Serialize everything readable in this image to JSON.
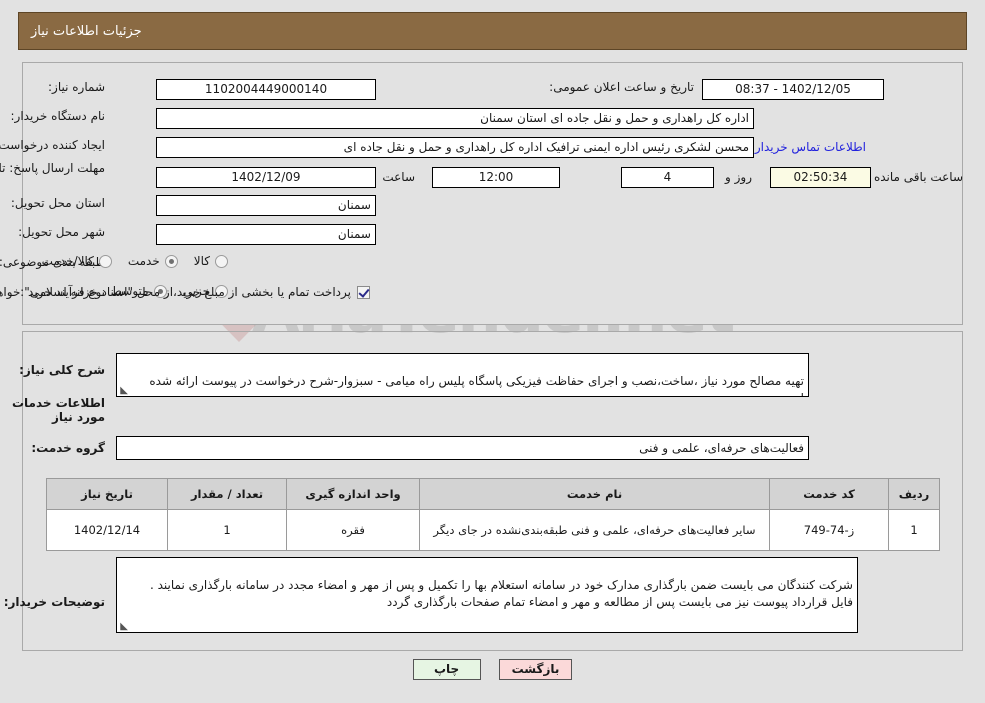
{
  "header": {
    "title": "جزئیات اطلاعات نیاز"
  },
  "form": {
    "need_number_label": "شماره نیاز:",
    "need_number_value": "1102004449000140",
    "announce_label": "تاریخ و ساعت اعلان عمومی:",
    "announce_value": "08:37 - 1402/12/05",
    "buyer_org_label": "نام دستگاه خریدار:",
    "buyer_org_value": "اداره کل راهداری و حمل و نقل جاده ای استان سمنان",
    "requester_label": "ایجاد کننده درخواست:",
    "requester_value": "محسن لشکری رئیس اداره ایمنی ترافیک اداره کل راهداری و حمل و نقل جاده ای",
    "buyer_contact_link": "اطلاعات تماس خریدار",
    "deadline_label": "مهلت ارسال پاسخ: تا تاریخ:",
    "deadline_date": "1402/12/09",
    "hour_label": "ساعت",
    "deadline_hour": "12:00",
    "days_value": "4",
    "days_label": "روز و",
    "countdown_value": "02:50:34",
    "countdown_label": "ساعت باقی مانده",
    "province_label": "استان محل تحویل:",
    "province_value": "سمنان",
    "city_label": "شهر محل تحویل:",
    "city_value": "سمنان",
    "category_label": "طبقه بندی موضوعی:",
    "category_options": [
      {
        "label": "کالا",
        "selected": false
      },
      {
        "label": "خدمت",
        "selected": true
      },
      {
        "label": "کالا/خدمت",
        "selected": false
      }
    ],
    "process_label": "نوع فرآیند خرید :",
    "process_options": [
      {
        "label": "جزیی",
        "selected": false
      },
      {
        "label": "متوسط",
        "selected": true
      }
    ],
    "treasury_checkbox_checked": true,
    "treasury_note": "پرداخت تمام یا بخشی از مبلغ خرید،از محل \"اسناد خزانه اسلامی\" خواهد بود."
  },
  "summary": {
    "label": "شرح کلی نیاز:",
    "value": "تهیه مصالح مورد نیاز ،ساخت،نصب و اجرای حفاظت فیزیکی پاسگاه پلیس راه میامی - سبزوار-شرح درخواست در پیوست ارائه شده است."
  },
  "services_section": {
    "title": "اطلاعات خدمات مورد نیاز",
    "group_label": "گروه خدمت:",
    "group_value": "فعالیت‌های حرفه‌ای، علمی و فنی"
  },
  "table": {
    "columns": [
      "ردیف",
      "کد خدمت",
      "نام خدمت",
      "واحد اندازه گیری",
      "تعداد / مقدار",
      "تاریخ نیاز"
    ],
    "rows": [
      {
        "index": "1",
        "code": "ز-74-749",
        "name": "سایر فعالیت‌های حرفه‌ای، علمی و فنی طبقه‌بندی‌نشده در جای دیگر",
        "unit": "فقره",
        "quantity": "1",
        "date": "1402/12/14"
      }
    ]
  },
  "buyer_notes": {
    "label": "توضیحات خریدار:",
    "value": "شرکت کنندگان می بایست ضمن بارگذاری مدارک خود در سامانه استعلام بها را تکمیل و پس از مهر و امضاء مجدد در سامانه بارگذاری نمایند .\nفایل قرارداد پیوست نیز می بایست پس از مطالعه و مهر و امضاء تمام صفحات بارگذاری گردد"
  },
  "buttons": {
    "print": "چاپ",
    "back": "بازگشت"
  },
  "watermark": {
    "text": "AriaTender.net"
  }
}
